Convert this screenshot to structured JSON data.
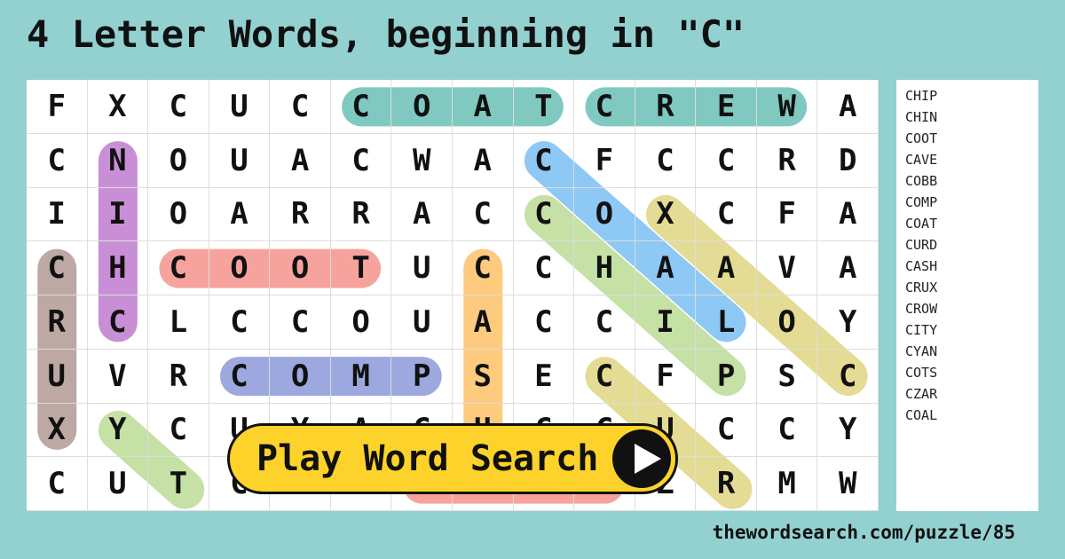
{
  "title": "4 Letter Words, beginning in \"C\"",
  "grid": [
    [
      "F",
      "X",
      "C",
      "U",
      "C",
      "C",
      "O",
      "A",
      "T",
      "C",
      "R",
      "E",
      "W",
      "A"
    ],
    [
      "C",
      "N",
      "O",
      "U",
      "A",
      "C",
      "W",
      "A",
      "C",
      "F",
      "C",
      "C",
      "R",
      "D"
    ],
    [
      "I",
      "I",
      "O",
      "A",
      "R",
      "R",
      "A",
      "C",
      "C",
      "O",
      "X",
      "C",
      "F",
      "A"
    ],
    [
      "C",
      "H",
      "C",
      "O",
      "O",
      "T",
      "U",
      "C",
      "C",
      "H",
      "A",
      "A",
      "V",
      "A"
    ],
    [
      "R",
      "C",
      "L",
      "C",
      "C",
      "O",
      "U",
      "A",
      "C",
      "C",
      "I",
      "L",
      "O",
      "Y"
    ],
    [
      "U",
      "V",
      "R",
      "C",
      "O",
      "M",
      "P",
      "S",
      "E",
      "C",
      "F",
      "P",
      "S",
      "C"
    ],
    [
      "X",
      "Y",
      "C",
      "U",
      "Y",
      "A",
      "C",
      "H",
      "C",
      "C",
      "U",
      "C",
      "C",
      "Y"
    ],
    [
      "C",
      "U",
      "T",
      "C",
      "O",
      "O",
      "C",
      "I",
      "T",
      "Y",
      "Z",
      "R",
      "M",
      "W"
    ]
  ],
  "highlights": [
    {
      "word": "COAT",
      "color": "#7fc9c0",
      "from": [
        0,
        5
      ],
      "to": [
        0,
        8
      ]
    },
    {
      "word": "CREW",
      "color": "#7fc9c0",
      "from": [
        0,
        9
      ],
      "to": [
        0,
        12
      ]
    },
    {
      "word": "CHIN",
      "color": "#c98fd6",
      "from": [
        4,
        1
      ],
      "to": [
        1,
        1
      ]
    },
    {
      "word": "COOT",
      "color": "#f7a39d",
      "from": [
        3,
        2
      ],
      "to": [
        3,
        5
      ]
    },
    {
      "word": "CRUX",
      "color": "#bda8a3",
      "from": [
        3,
        0
      ],
      "to": [
        6,
        0
      ]
    },
    {
      "word": "COMP",
      "color": "#9ca8de",
      "from": [
        5,
        3
      ],
      "to": [
        5,
        6
      ]
    },
    {
      "word": "CASH",
      "color": "#fdca7e",
      "from": [
        3,
        7
      ],
      "to": [
        6,
        7
      ]
    },
    {
      "word": "COAL",
      "color": "#8ec8f5",
      "from": [
        1,
        8
      ],
      "to": [
        4,
        11
      ]
    },
    {
      "word": "CHIP",
      "color": "#c5e1a5",
      "from": [
        2,
        8
      ],
      "to": [
        5,
        11
      ]
    },
    {
      "word": "",
      "color": "#e4dc94",
      "from": [
        2,
        10
      ],
      "to": [
        5,
        13
      ]
    },
    {
      "word": "CURD",
      "color": "#e4dc94",
      "from": [
        5,
        9
      ],
      "to": [
        8,
        12
      ]
    },
    {
      "word": "",
      "color": "#c5e1a5",
      "from": [
        6,
        1
      ],
      "to": [
        9,
        4
      ]
    },
    {
      "word": "CITY",
      "color": "#f7a39d",
      "from": [
        7,
        6
      ],
      "to": [
        7,
        9
      ]
    }
  ],
  "word_list": [
    "CHIP",
    "CHIN",
    "COOT",
    "CAVE",
    "COBB",
    "COMP",
    "COAT",
    "CURD",
    "CASH",
    "CRUX",
    "CROW",
    "CITY",
    "CYAN",
    "COTS",
    "CZAR",
    "COAL"
  ],
  "play_button": {
    "label": "Play Word Search",
    "icon": "play-icon"
  },
  "url": "thewordsearch.com/puzzle/85"
}
